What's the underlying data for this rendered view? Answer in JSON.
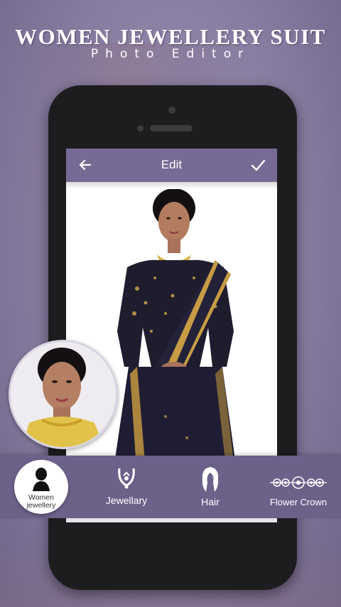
{
  "banner": {
    "title": "Women Jewellery Suit",
    "subtitle": "Photo Editor"
  },
  "editor": {
    "back_icon": "arrow-left-icon",
    "title": "Edit",
    "confirm_icon": "checkmark-icon",
    "appbar_color": "#776a94"
  },
  "toolbar": {
    "color": "#6c6189",
    "items": [
      {
        "label": "Women\njewellery",
        "icon": "woman-silhouette-icon",
        "selected": true
      },
      {
        "label": "Jewellary",
        "icon": "necklace-icon",
        "selected": false
      },
      {
        "label": "Hair",
        "icon": "hair-icon",
        "selected": false
      },
      {
        "label": "Flower Crown",
        "icon": "flower-crown-icon",
        "selected": false
      }
    ]
  }
}
